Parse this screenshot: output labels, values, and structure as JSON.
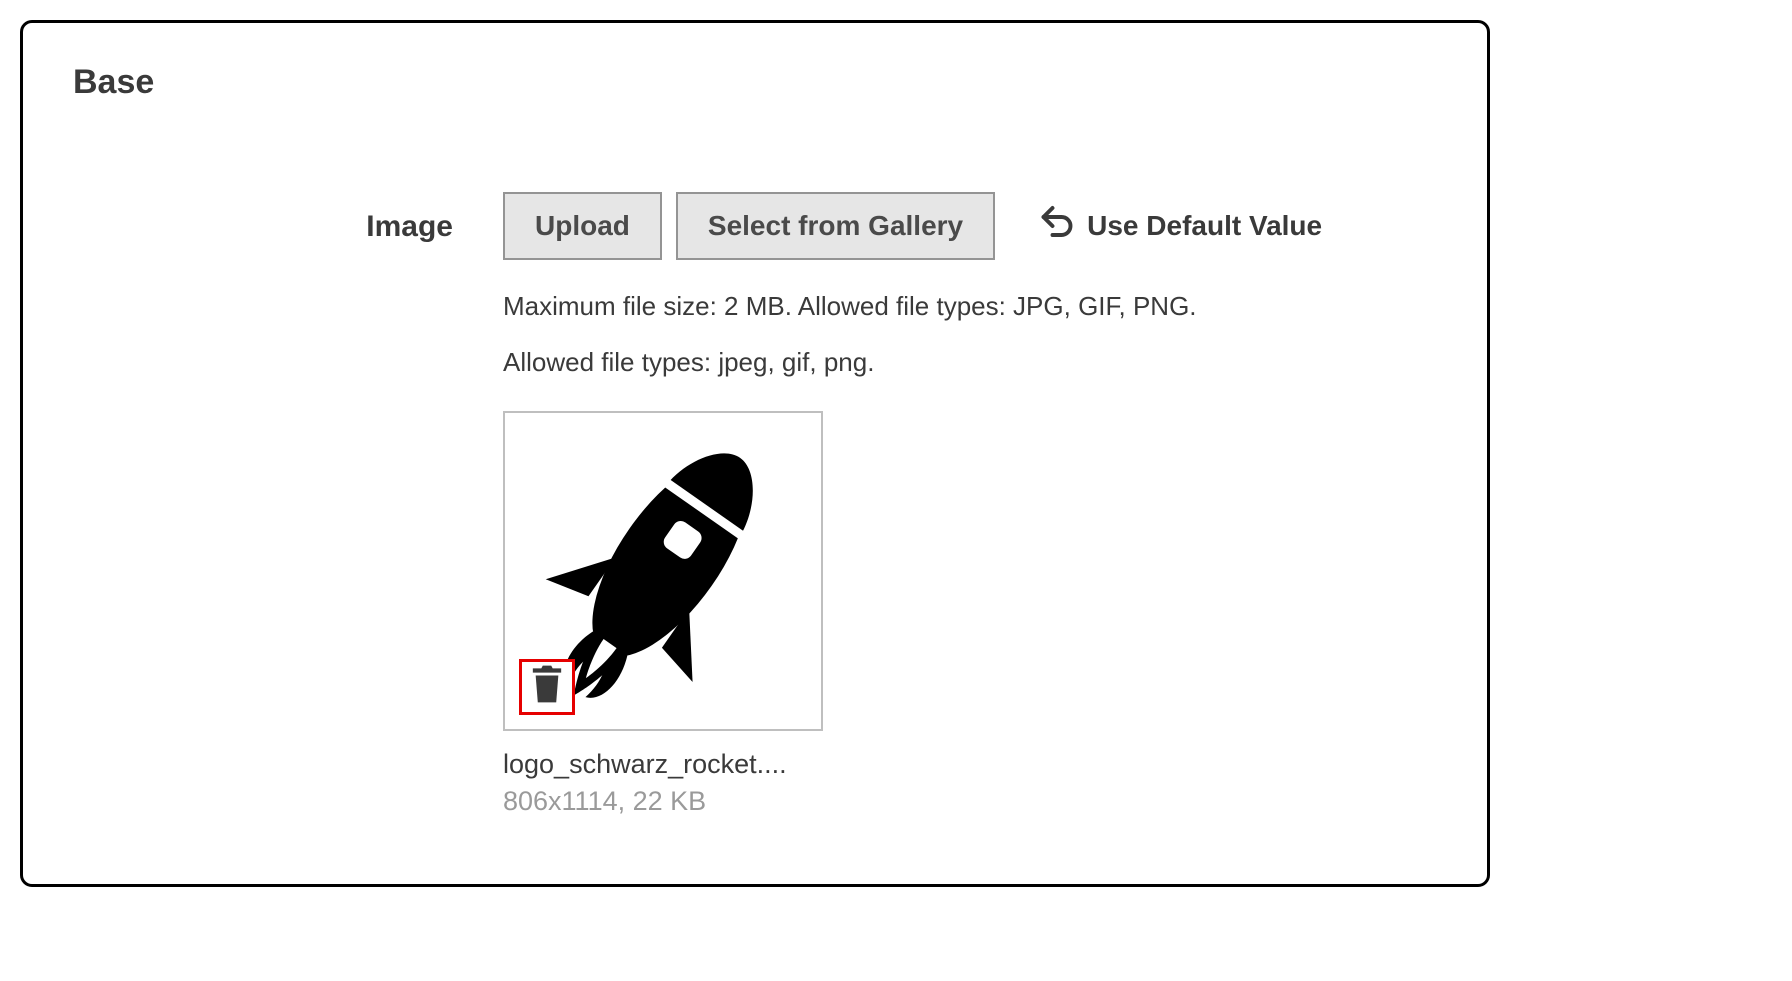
{
  "section": {
    "title": "Base"
  },
  "field": {
    "label": "Image",
    "upload_label": "Upload",
    "gallery_label": "Select from Gallery",
    "reset_label": "Use Default Value",
    "help1": "Maximum file size: 2 MB. Allowed file types: JPG, GIF, PNG.",
    "help2": "Allowed file types: jpeg, gif, png."
  },
  "file": {
    "name": "logo_schwarz_rocket....",
    "meta": "806x1114, 22 KB"
  }
}
